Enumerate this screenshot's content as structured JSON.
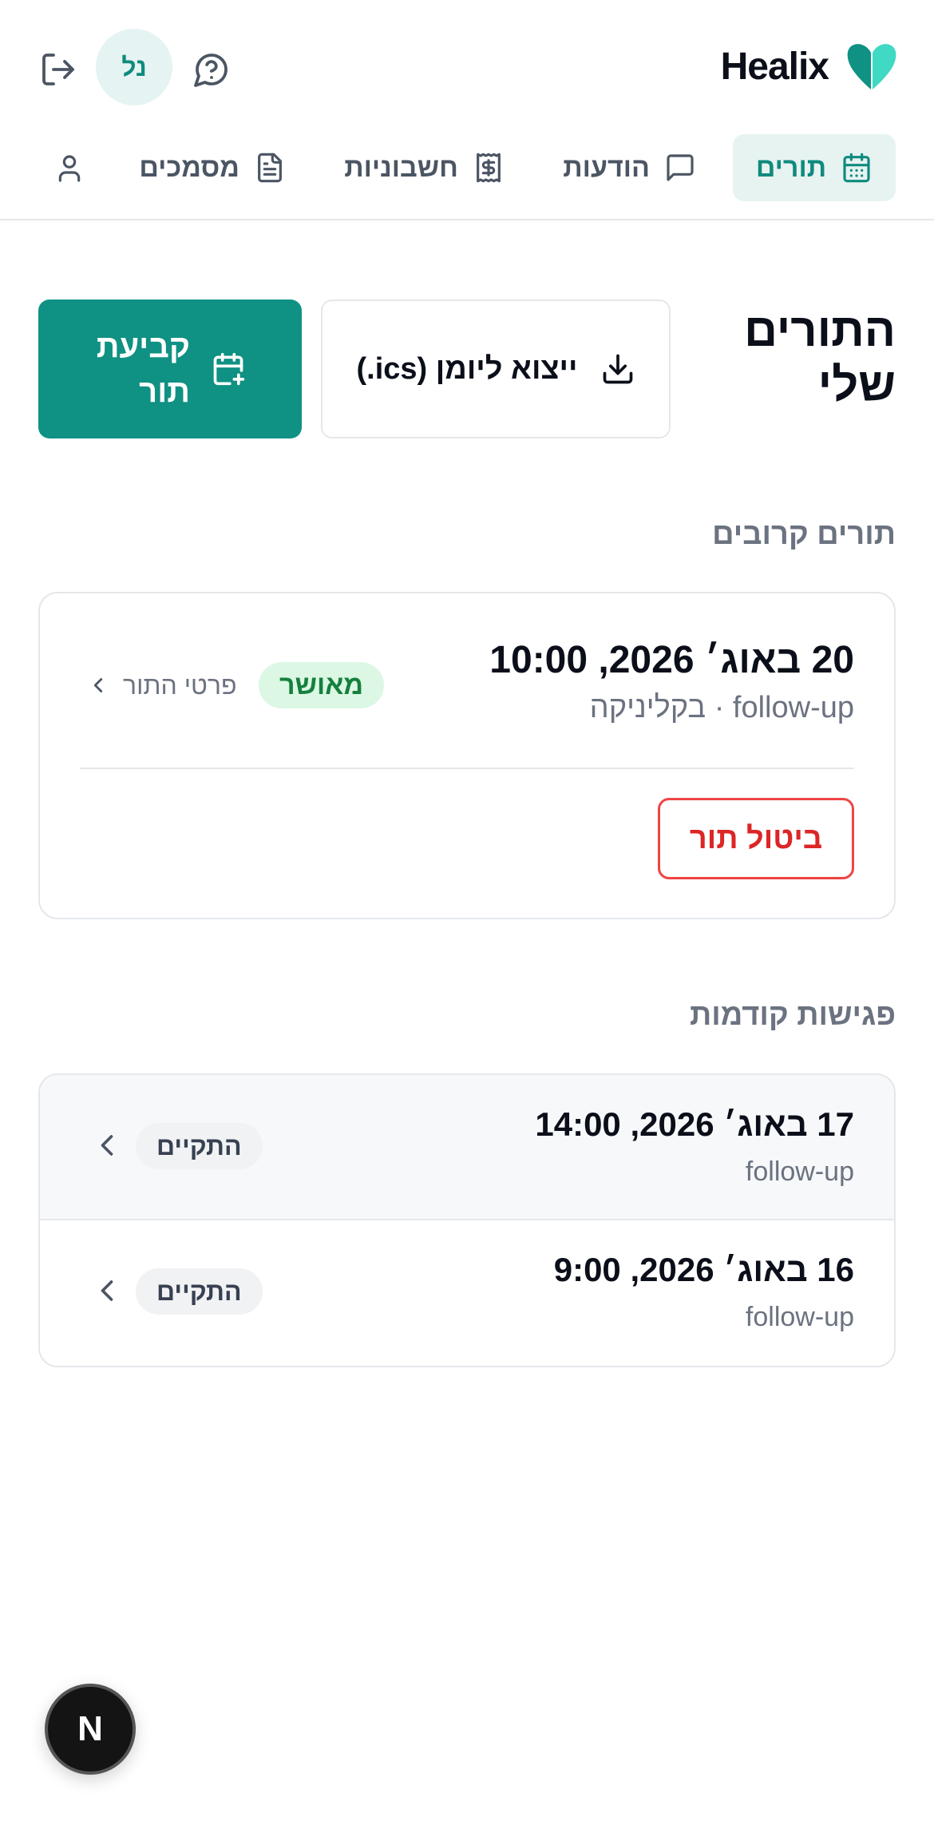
{
  "app": {
    "brand_name": "Healix",
    "user_initials": "נל"
  },
  "nav": {
    "tabs": [
      {
        "label": "תורים",
        "icon": "calendar-icon",
        "active": true
      },
      {
        "label": "הודעות",
        "icon": "message-square-icon",
        "active": false
      },
      {
        "label": "חשבוניות",
        "icon": "receipt-icon",
        "active": false
      },
      {
        "label": "מסמכים",
        "icon": "document-icon",
        "active": false
      }
    ],
    "profile_icon": "user-icon"
  },
  "page": {
    "title": "התורים שלי",
    "book_button": "קביעת תור",
    "export_button": "ייצוא ליומן (ics.)"
  },
  "upcoming": {
    "section_title": "תורים קרובים",
    "items": [
      {
        "date": "20 באוג׳ 2026, 10:00",
        "subtitle": "follow-up · בקליניקה",
        "status": "מאושר",
        "details_link": "פרטי התור",
        "cancel_button": "ביטול תור"
      }
    ]
  },
  "past": {
    "section_title": "פגישות קודמות",
    "items": [
      {
        "date": "17 באוג׳ 2026, 14:00",
        "type": "follow-up",
        "status": "התקיים"
      },
      {
        "date": "16 באוג׳ 2026, 9:00",
        "type": "follow-up",
        "status": "התקיים"
      }
    ]
  },
  "fab": {
    "label": "N"
  },
  "colors": {
    "accent": "#0f9183",
    "accent_light": "#e7f3f1",
    "confirmed_bg": "#dcf7e4",
    "confirmed_text": "#15803d",
    "danger": "#dc2626"
  }
}
